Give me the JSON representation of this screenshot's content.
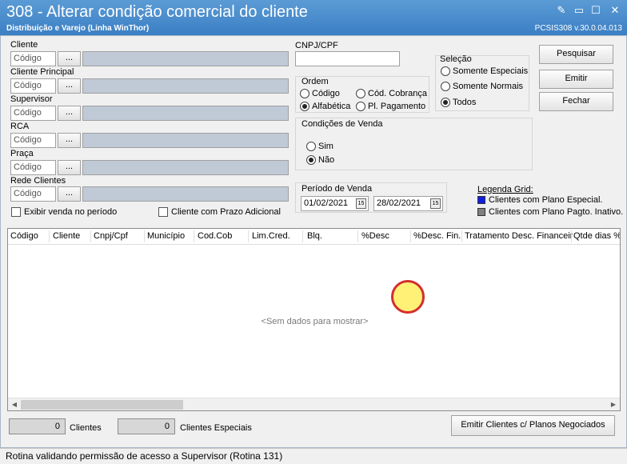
{
  "window": {
    "title": "308 - Alterar condição comercial do cliente",
    "subtitle": "Distribuição e Varejo (Linha WinThor)",
    "version": "PCSIS308  v.30.0.04.013",
    "buttons": {
      "edit": "✎",
      "minimize": "▭",
      "maximize": "☐",
      "close": "✕"
    }
  },
  "filters": {
    "cliente_label": "Cliente",
    "cliente_principal_label": "Cliente Principal",
    "supervisor_label": "Supervisor",
    "rca_label": "RCA",
    "praca_label": "Praça",
    "rede_clientes_label": "Rede Clientes",
    "codigo_placeholder": "Código",
    "lookup_button": "...",
    "exibir_venda_label": "Exibir venda no período",
    "prazo_adicional_label": "Cliente com Prazo Adicional"
  },
  "cnpj": {
    "label": "CNPJ/CPF",
    "value": ""
  },
  "ordem": {
    "label": "Ordem",
    "options": [
      "Código",
      "Cód. Cobrança",
      "Alfabética",
      "Pl. Pagamento"
    ],
    "selected": "Alfabética"
  },
  "selecao": {
    "label": "Seleção",
    "options": [
      "Somente Especiais",
      "Somente Normais",
      "Todos"
    ],
    "selected": "Todos"
  },
  "condicoes_venda": {
    "label": "Condições de Venda",
    "options": [
      "Sim",
      "Não"
    ],
    "selected": "Não"
  },
  "periodo": {
    "label": "Período de Venda",
    "start": "01/02/2021",
    "end": "28/02/2021",
    "calendar_icon": "15"
  },
  "actions": {
    "pesquisar": "Pesquisar",
    "emitir": "Emitir",
    "fechar": "Fechar"
  },
  "legenda": {
    "title": "Legenda Grid:",
    "items": [
      {
        "label": "Clientes com Plano Especial.",
        "color": "#1020e0"
      },
      {
        "label": "Clientes com Plano Pagto. Inativo.",
        "color": "#808080"
      }
    ]
  },
  "grid": {
    "columns": [
      "Código",
      "Cliente",
      "Cnpj/Cpf",
      "Município",
      "Cod.Cob",
      "Lim.Cred.",
      "Blq.",
      "%Desc",
      "%Desc. Fin.",
      "Tratamento Desc. Financeir",
      "Qtde dias %"
    ],
    "empty_text": "<Sem dados para mostrar>"
  },
  "footer": {
    "clientes_count": "0",
    "clientes_label": "Clientes",
    "especiais_count": "0",
    "especiais_label": "Clientes Especiais",
    "emitir_planos_button": "Emitir Clientes c/ Planos Negociados"
  },
  "status": {
    "text": "Rotina validando permissão de acesso a Supervisor (Rotina 131)"
  },
  "colors": {
    "titlebar": "#3b7fc4",
    "readonly_field": "#c0c9d6",
    "cursor_fill": "#fff176",
    "cursor_ring": "#d32f2f"
  }
}
